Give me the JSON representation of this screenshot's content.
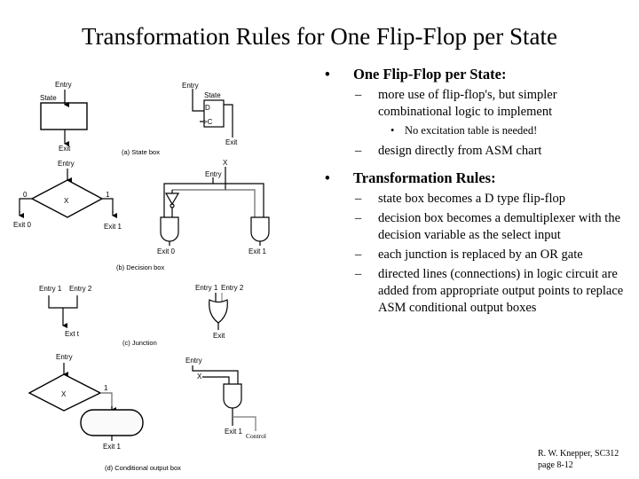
{
  "title": "Transformation Rules for One Flip-Flop per State",
  "diagram": {
    "state_box": {
      "asm": {
        "entry": "Entry",
        "state": "State",
        "exit": "Exit"
      },
      "circuit": {
        "entry": "Entry",
        "state": "State",
        "d": "D",
        "c": ">C",
        "exit": "Exit"
      },
      "caption": "(a) State box"
    },
    "decision_box": {
      "asm": {
        "entry": "Entry",
        "variable": "X",
        "zero": "0",
        "one": "1",
        "exit0": "Exit 0",
        "exit1": "Exit 1"
      },
      "circuit": {
        "x": "X",
        "entry": "Entry",
        "exit0": "Exit 0",
        "exit1": "Exit 1"
      },
      "caption": "(b) Decision box"
    },
    "junction": {
      "asm": {
        "entry1": "Entry 1",
        "entry2": "Entry 2",
        "exit": "Ext t"
      },
      "circuit": {
        "entry1": "Entry 1",
        "entry2": "Entry 2",
        "exit": "Exit"
      },
      "caption": "(c) Junction"
    },
    "conditional_output": {
      "asm": {
        "entry": "Entry",
        "variable": "X",
        "one": "1",
        "exit1": "Exit 1"
      },
      "circuit": {
        "entry": "Entry",
        "x": "X",
        "exit1": "Exit 1",
        "control": "Control"
      },
      "caption": "(d) Conditional output box"
    }
  },
  "bullets": [
    {
      "text": "One Flip-Flop per State:",
      "marker": "•",
      "children": [
        {
          "text": "more use of flip-flop's, but simpler combinational logic to implement",
          "marker": "–",
          "children": [
            {
              "text": "No excitation table is needed!",
              "marker": "•"
            }
          ]
        },
        {
          "text": "design directly from ASM chart",
          "marker": "–"
        }
      ]
    },
    {
      "text": "Transformation Rules:",
      "marker": "•",
      "children": [
        {
          "text": "state box becomes a D type flip-flop",
          "marker": "–"
        },
        {
          "text": "decision box becomes a demultiplexer with the decision variable as the select input",
          "marker": "–"
        },
        {
          "text": "each junction is replaced by an OR gate",
          "marker": "–"
        },
        {
          "text": "directed lines (connections) in logic circuit are added from appropriate output points to replace ASM conditional output boxes",
          "marker": "–"
        }
      ]
    }
  ],
  "footer": {
    "author": "R. W. Knepper, SC312",
    "page": "page 8-12"
  }
}
